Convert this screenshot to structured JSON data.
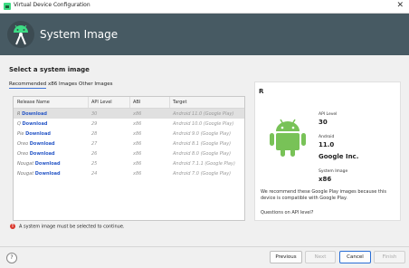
{
  "window": {
    "title": "Virtual Device Configuration",
    "close_glyph": "✕"
  },
  "header": {
    "title": "System Image"
  },
  "section": {
    "label": "Select a system image"
  },
  "tabs": [
    {
      "label": "Recommended",
      "active": true
    },
    {
      "label": "x86 Images",
      "active": false
    },
    {
      "label": "Other Images",
      "active": false
    }
  ],
  "table": {
    "columns": [
      "Release Name",
      "API Level",
      "ABI",
      "Target"
    ],
    "rows": [
      {
        "release": "R",
        "action": "Download",
        "api": "30",
        "abi": "x86",
        "target": "Android 11.0 (Google Play)",
        "selected": true
      },
      {
        "release": "Q",
        "action": "Download",
        "api": "29",
        "abi": "x86",
        "target": "Android 10.0 (Google Play)",
        "selected": false
      },
      {
        "release": "Pie",
        "action": "Download",
        "api": "28",
        "abi": "x86",
        "target": "Android 9.0 (Google Play)",
        "selected": false
      },
      {
        "release": "Oreo",
        "action": "Download",
        "api": "27",
        "abi": "x86",
        "target": "Android 8.1 (Google Play)",
        "selected": false
      },
      {
        "release": "Oreo",
        "action": "Download",
        "api": "26",
        "abi": "x86",
        "target": "Android 8.0 (Google Play)",
        "selected": false
      },
      {
        "release": "Nougat",
        "action": "Download",
        "api": "25",
        "abi": "x86",
        "target": "Android 7.1.1 (Google Play)",
        "selected": false
      },
      {
        "release": "Nougat",
        "action": "Download",
        "api": "24",
        "abi": "x86",
        "target": "Android 7.0 (Google Play)",
        "selected": false
      }
    ]
  },
  "detail": {
    "release_name": "R",
    "api_label": "API Level",
    "api_value": "30",
    "android_label": "Android",
    "android_value": "11.0",
    "vendor": "Google Inc.",
    "system_image_label": "System Image",
    "system_image_value": "x86",
    "description": "We recommend these Google Play images because this device is compatible with Google Play.",
    "question": "Questions on API level?"
  },
  "error": {
    "message": "A system image must be selected to continue.",
    "glyph": "!"
  },
  "footer": {
    "help": "?",
    "previous": "Previous",
    "next": "Next",
    "cancel": "Cancel",
    "finish": "Finish"
  },
  "colors": {
    "header_bg": "#475a63",
    "android_green": "#78c257",
    "link_blue": "#2a59c7",
    "error_red": "#d9362b"
  }
}
